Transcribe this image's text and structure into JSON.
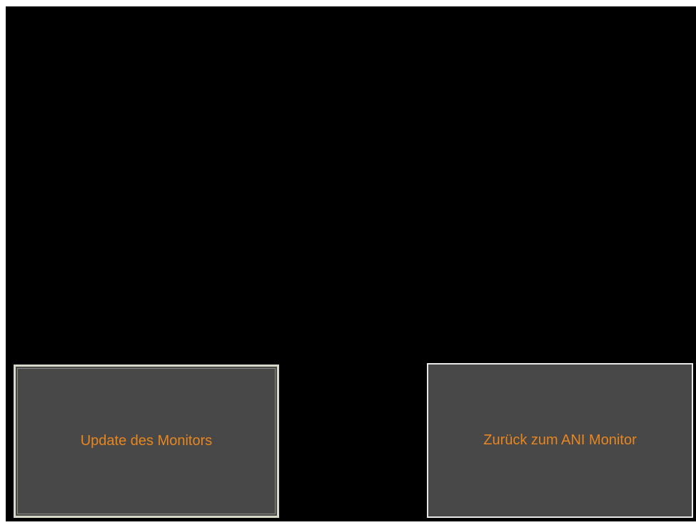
{
  "buttons": {
    "update_label": "Update des Monitors",
    "back_label": "Zurück zum ANI Monitor"
  },
  "colors": {
    "background": "#000000",
    "button_fill": "#484848",
    "label_text": "#e8861f",
    "button_border": "#e8e8e8"
  }
}
